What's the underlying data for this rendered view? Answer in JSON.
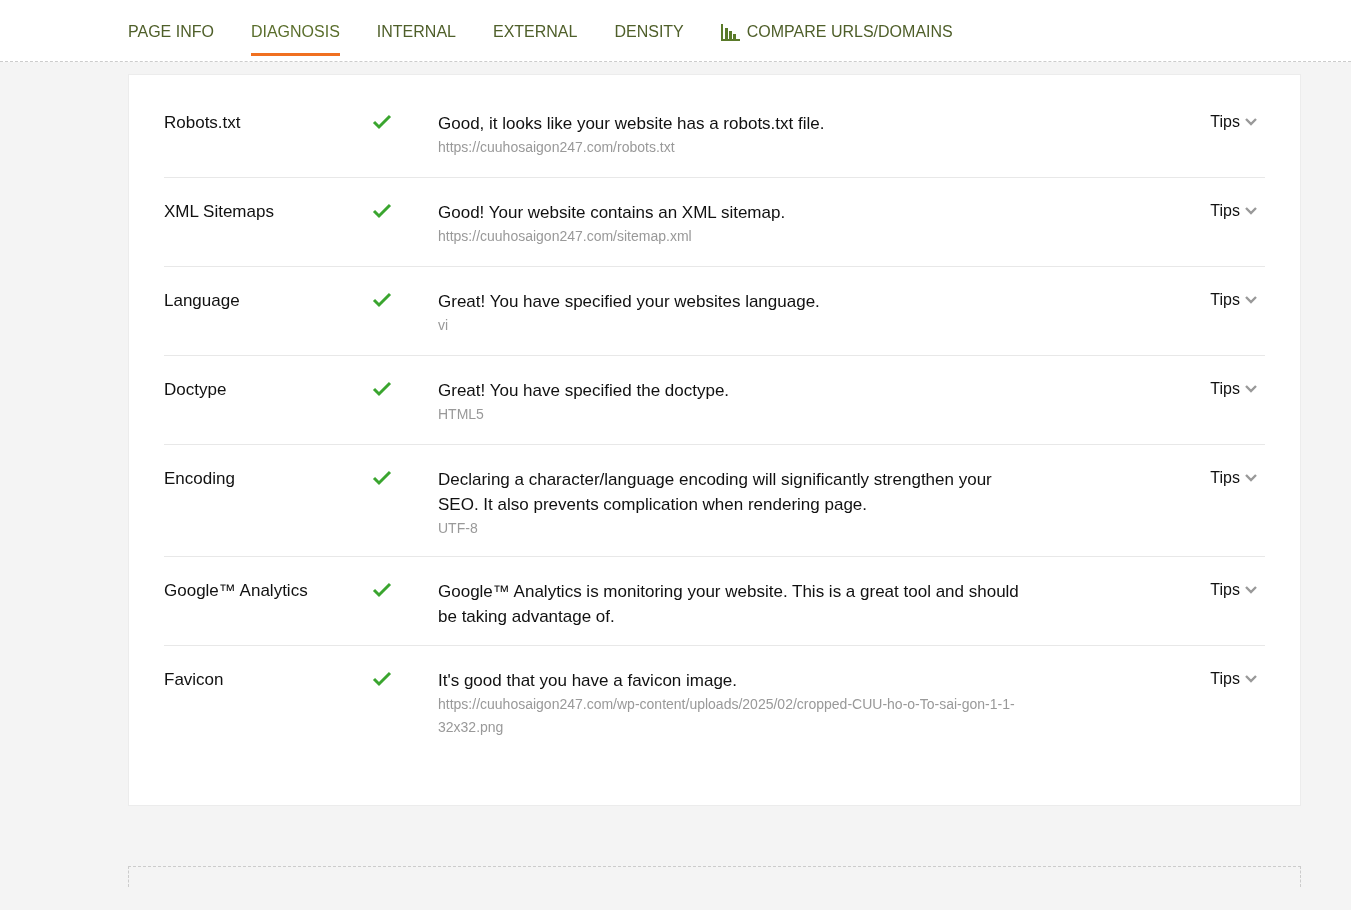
{
  "tabs": [
    {
      "label": "PAGE INFO",
      "selected": false
    },
    {
      "label": "DIAGNOSIS",
      "selected": true
    },
    {
      "label": "INTERNAL",
      "selected": false
    },
    {
      "label": "EXTERNAL",
      "selected": false
    },
    {
      "label": "DENSITY",
      "selected": false
    },
    {
      "label": "COMPARE URLS/DOMAINS",
      "selected": false,
      "kind": "chart"
    }
  ],
  "checks": [
    {
      "name": "Robots.txt",
      "passed": true,
      "message": "Good, it looks like your website has a robots.txt file.",
      "detail": "https://cuuhosaigon247.com/robots.txt",
      "tips": "Tips",
      "expanded": false
    },
    {
      "name": "XML Sitemaps",
      "passed": true,
      "message": "Good! Your website contains an XML sitemap.",
      "detail": "https://cuuhosaigon247.com/sitemap.xml",
      "tips": "Tips",
      "expanded": false
    },
    {
      "name": "Language",
      "passed": true,
      "message": "Great! You have specified your websites language.",
      "detail": "vi",
      "tips": "Tips",
      "expanded": false
    },
    {
      "name": "Doctype",
      "passed": true,
      "message": "Great! You have specified the doctype.",
      "detail": "HTML5",
      "tips": "Tips",
      "expanded": false
    },
    {
      "name": "Encoding",
      "passed": true,
      "message": "Declaring a character/language encoding will significantly strengthen your SEO. It also prevents complication when rendering page.",
      "detail": "UTF-8",
      "tips": "Tips",
      "expanded": false
    },
    {
      "name": "Google™ Analytics",
      "passed": true,
      "message": "Google™ Analytics is monitoring your website. This is a great tool and should be taking advantage of.",
      "tips": "Tips",
      "expanded": false
    },
    {
      "name": "Favicon",
      "passed": true,
      "message": "It's good that you have a favicon image.",
      "detail": "https://cuuhosaigon247.com/wp-content/uploads/2025/02/cropped-CUU-ho-o-To-sai-gon-1-1-32x32.png",
      "tips": "Tips",
      "expanded": false
    }
  ]
}
